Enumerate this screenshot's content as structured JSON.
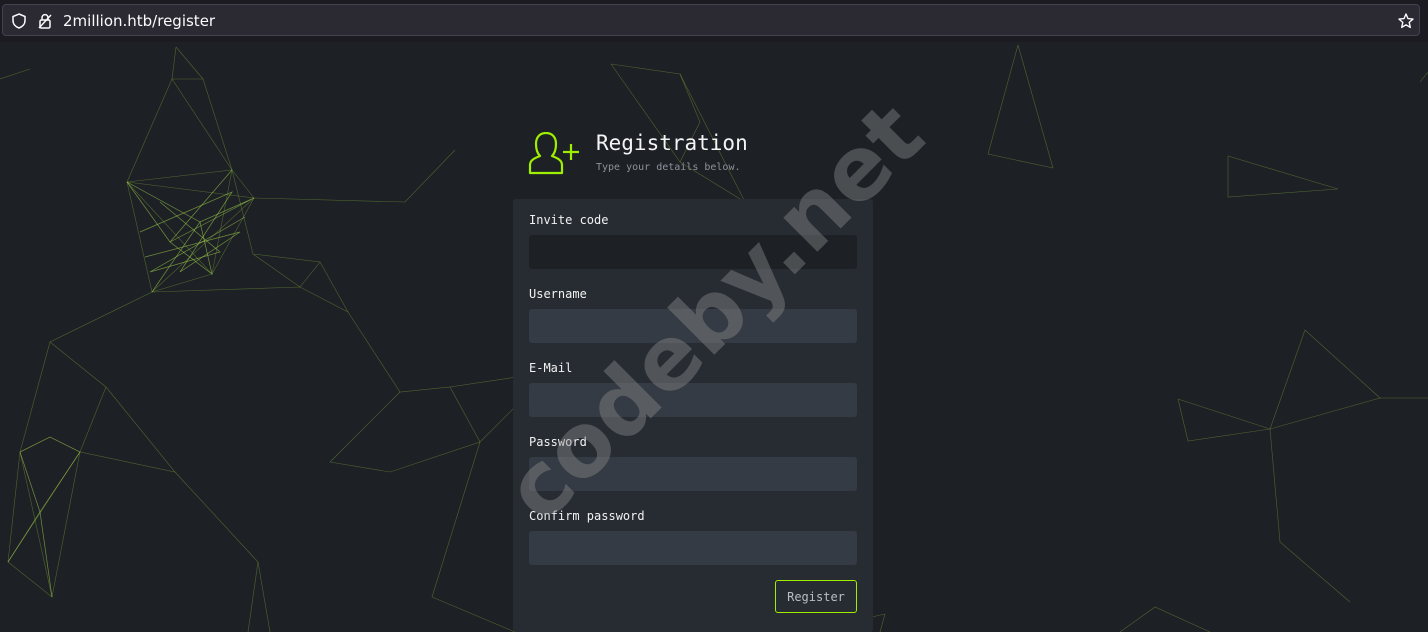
{
  "browser": {
    "url": "2million.htb/register",
    "icons": [
      "shield-icon",
      "lock-icon",
      "star-icon"
    ]
  },
  "header": {
    "icon": "user-plus-icon",
    "title": "Registration",
    "subtitle": "Type your details below."
  },
  "form": {
    "invite_code_label": "Invite code",
    "invite_code_value": "",
    "username_label": "Username",
    "username_value": "",
    "email_label": "E-Mail",
    "email_value": "",
    "password_label": "Password",
    "password_value": "",
    "confirm_password_label": "Confirm password",
    "confirm_password_value": "",
    "register_label": "Register"
  },
  "watermark": "codeby.net",
  "colors": {
    "background": "#1d2126",
    "panel": "#272c33",
    "input": "#353b44",
    "accent": "#9fef00",
    "browser_bar": "#1c1b22"
  }
}
